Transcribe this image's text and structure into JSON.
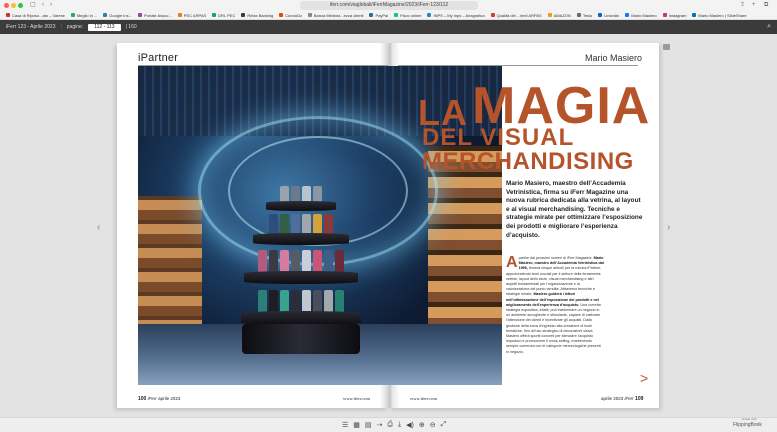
{
  "browser": {
    "url": "iferr.com/viaglobali/iFerrMagazine/2023/iFerr-123/112",
    "bookmarks": [
      {
        "label": "Casa di Riposo...ato – Varese",
        "color": "#c0392b"
      },
      {
        "label": "Meglio in ...",
        "color": "#27ae60"
      },
      {
        "label": "Google Ins...",
        "color": "#2980b9"
      },
      {
        "label": "Portale Assoc...",
        "color": "#8e44ad"
      },
      {
        "label": "PEC ARPAS",
        "color": "#e67e22"
      },
      {
        "label": "DRL PEC",
        "color": "#16a085"
      },
      {
        "label": "Relax Banking",
        "color": "#2c3e50"
      },
      {
        "label": "CondoDz",
        "color": "#d35400"
      },
      {
        "label": "Banca Mediola...ezza clienti",
        "color": "#7f8c8d"
      },
      {
        "label": "PayPal",
        "color": "#2471a3"
      },
      {
        "label": "Fisco online",
        "color": "#1abc9c"
      },
      {
        "label": "INPS – My Inps – Anagrafica",
        "color": "#2e86c1"
      },
      {
        "label": "Qualità del ...ienti ARPAS",
        "color": "#cb4335"
      },
      {
        "label": "AMAZON",
        "color": "#f39c12"
      },
      {
        "label": "Tesio",
        "color": "#5d6d7e"
      },
      {
        "label": "LinkedIn",
        "color": "#0a66c2"
      },
      {
        "label": "Mario Masiero",
        "color": "#1877f2"
      },
      {
        "label": "Instagram",
        "color": "#c13584"
      },
      {
        "label": "Mario Masiero | SlideShare",
        "color": "#0077b5"
      }
    ]
  },
  "viewer": {
    "issue": "iFerr 123 - Aprile 2023",
    "page_label": "pagine:",
    "page_value": "112 - 113",
    "extra": "| 160"
  },
  "magazine": {
    "brand": "iPartner",
    "author": "Mario Masiero",
    "title": {
      "la": "LA",
      "magia": "MAGIA",
      "del_visual": "DEL VISUAL",
      "merchandising": "MERCHANDISING"
    },
    "lead": "Mario Masiero, maestro dell’Accademia Vetrinistica, firma su iFerr Magazine una nuova rubrica dedicata alla vetrina, al layout e al visual merchandising. Tecniche e strategie mirate per ottimizzare l’esposizione dei prodotti e migliorare l’esperienza d’acquisto.",
    "body": {
      "drop_cap": "A",
      "part1": "partire dai prossimi numeri di iFerr Magazine, ",
      "bold1": "Mario Masiero, maestro dell’Accademia Vetrinistica dal 1996,",
      "part2": " firmerà cinque articoli per la rubrica iPartner, approfondendo temi cruciali per il settore della ferramenta: vetrine, layout dello store, visual merchandising e altri aspetti fondamentali per l’organizzazione e la valorizzazione del punto vendita. Attraverso tecniche e strategie mirate, ",
      "bold2": "Masiero guiderà i lettori nell’ottimizzazione dell’esposizione dei prodotti e nel miglioramento dell’esperienza d’acquisto.",
      "part3": " Una corretta strategia espositiva, infatti, può trasformare un negozio in un ambiente accogliente e stimolante, capace di catturare l’attenzione dei clienti e incentivare gli acquisti. Dalla gestione della zona d’ingresso alla creazione di isole tematiche, fino all’uso strategico di decorazioni visive, Masiero offrirà spunti concreti per stimolare l’acquisto impulsivo e promuovere il cross-selling, mantenendo sempre coerenza con le categorie merceologiche presenti in negozio."
    },
    "footer": {
      "left_page": "100",
      "left_brand": "iFerr",
      "left_date": "aprile 2023",
      "left_site": "www.iferr.com",
      "right_site": "www.iferr.com",
      "right_date": "aprile 2023",
      "right_brand": "iFerr",
      "right_page": "109"
    }
  },
  "bottom_bar": {
    "brand": "FlippingBook",
    "small": "create with"
  },
  "colors": {
    "accent": "#b5532a",
    "toolbar": "#3b3b3b"
  }
}
